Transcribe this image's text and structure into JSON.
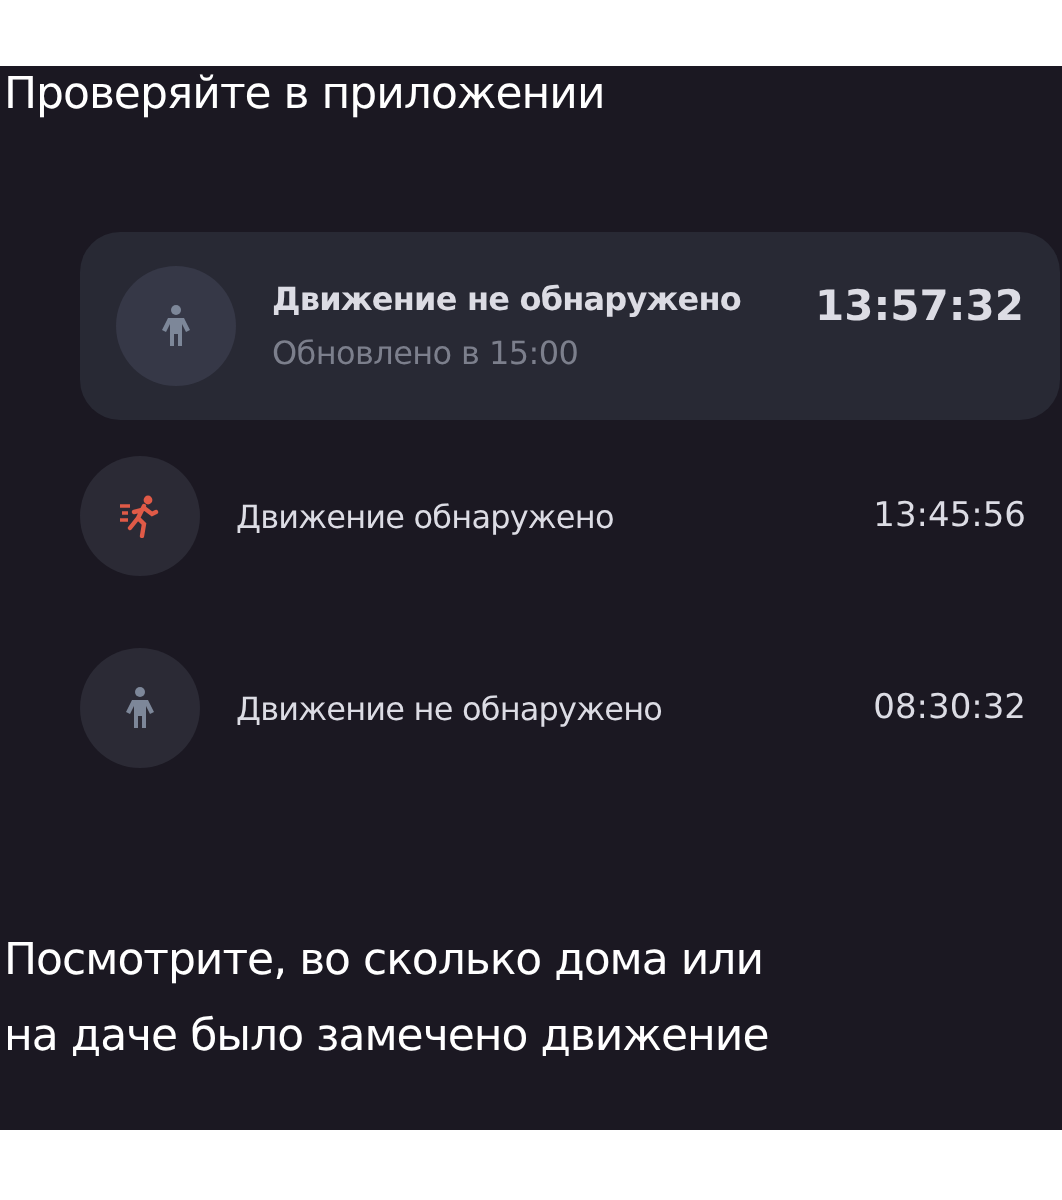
{
  "heading": "Проверяйте в приложении",
  "events": [
    {
      "status": "Движение не обнаружено",
      "detected": false,
      "highlighted": true,
      "subtitle": "Обновлено в 15:00",
      "time": "13:57:32"
    },
    {
      "status": "Движение обнаружено",
      "detected": true,
      "highlighted": false,
      "time": "13:45:56"
    },
    {
      "status": "Движение не обнаружено",
      "detected": false,
      "highlighted": false,
      "time": "08:30:32"
    }
  ],
  "caption": "Посмотрите, во сколько дома или на даче было замечено движение"
}
